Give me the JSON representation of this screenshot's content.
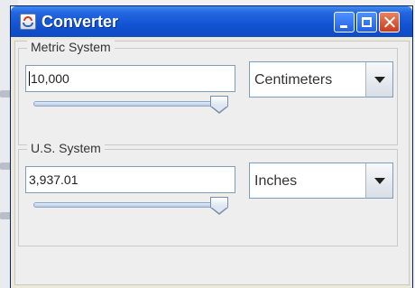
{
  "window": {
    "title": "Converter"
  },
  "metric": {
    "label": "Metric System",
    "value": "10,000",
    "unit": "Centimeters",
    "slider_position": 1.0
  },
  "us": {
    "label": "U.S. System",
    "value": "3,937.01",
    "unit": "Inches",
    "slider_position": 1.0
  },
  "icons": {
    "app": "java-icon",
    "minimize": "minimize-icon",
    "maximize": "maximize-icon",
    "close": "close-icon",
    "dropdown": "chevron-down-icon"
  },
  "colors": {
    "titlebar": "#1153d3",
    "close_button": "#c93c1b",
    "panel": "#eeeeee"
  }
}
